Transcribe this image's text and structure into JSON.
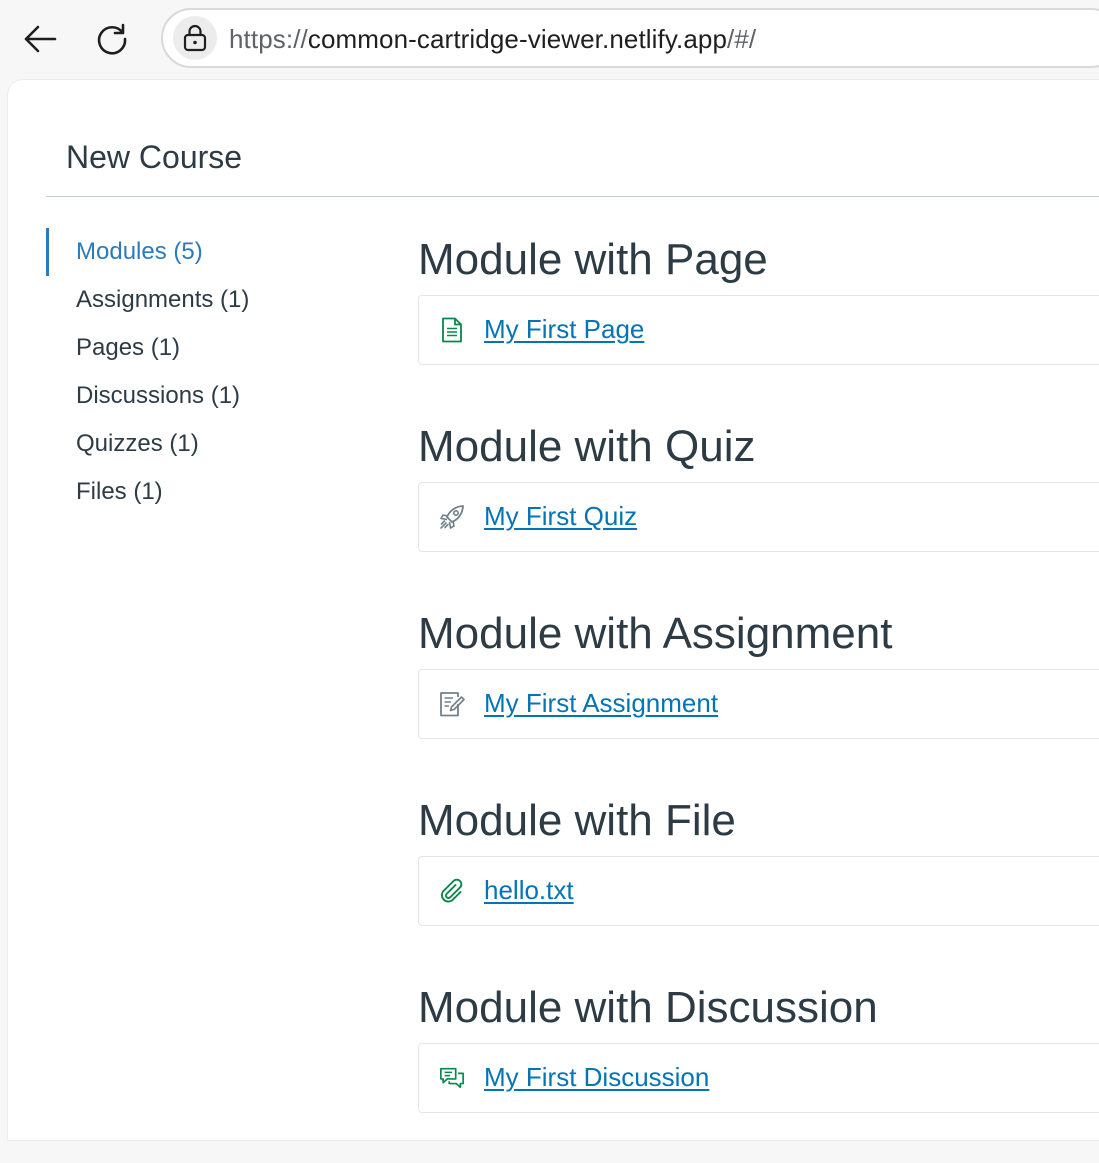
{
  "browser": {
    "url_protocol": "https://",
    "url_host": "common-cartridge-viewer.netlify.app",
    "url_path": "/#/",
    "icons": [
      "back-arrow-icon",
      "reload-icon",
      "lock-icon"
    ]
  },
  "course": {
    "title": "New Course"
  },
  "sidebar": {
    "items": [
      {
        "label": "Modules (5)",
        "active": true
      },
      {
        "label": "Assignments (1)",
        "active": false
      },
      {
        "label": "Pages (1)",
        "active": false
      },
      {
        "label": "Discussions (1)",
        "active": false
      },
      {
        "label": "Quizzes (1)",
        "active": false
      },
      {
        "label": "Files (1)",
        "active": false
      }
    ]
  },
  "modules": [
    {
      "title": "Module with Page",
      "item": {
        "label": "My First Page",
        "icon": "page-icon",
        "icon_color": "#0b874b"
      }
    },
    {
      "title": "Module with Quiz",
      "item": {
        "label": "My First Quiz",
        "icon": "rocket-quiz-icon",
        "icon_color": "#73818c"
      }
    },
    {
      "title": "Module with Assignment",
      "item": {
        "label": "My First Assignment",
        "icon": "assignment-icon",
        "icon_color": "#73818c"
      }
    },
    {
      "title": "Module with File",
      "item": {
        "label": "hello.txt",
        "icon": "paperclip-icon",
        "icon_color": "#0b874b"
      }
    },
    {
      "title": "Module with Discussion",
      "item": {
        "label": "My First Discussion",
        "icon": "discussion-icon",
        "icon_color": "#0b874b"
      }
    }
  ],
  "colors": {
    "link": "#0374b5",
    "active_nav": "#2b7abc",
    "text": "#2d3b45",
    "published_green": "#0b874b",
    "unpublished_gray": "#73818c"
  }
}
